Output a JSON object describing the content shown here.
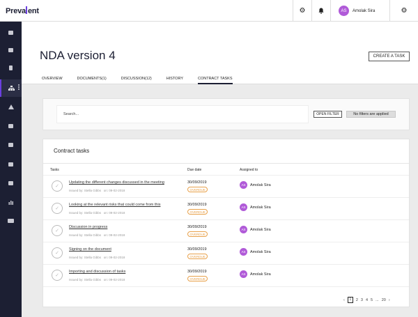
{
  "app": {
    "logo_left": "Preva",
    "logo_right": "ent"
  },
  "topbar": {
    "gear_icon": "gear-icon",
    "bell_icon": "bell-icon",
    "user": {
      "initials": "AS",
      "name": "Amolak Sira"
    },
    "settings_icon": "gear-icon"
  },
  "sidebar": {
    "items": [
      "dashboard-icon",
      "checklist-icon",
      "document-icon",
      "org-chart-icon",
      "warning-icon",
      "list-icon",
      "calendar-icon",
      "book-icon",
      "lines-icon",
      "bar-chart-icon",
      "team-icon"
    ],
    "active_index": 3
  },
  "header": {
    "title": "NDA version 4",
    "create_label": "CREATE A TASK",
    "tabs": [
      "OVERVIEW",
      "DOCUMENTS(1)",
      "DISCUSSION(12)",
      "HISTORY",
      "CONTRACT TASKS"
    ],
    "active_tab": 4
  },
  "filter": {
    "search_placeholder": "Search...",
    "open_filter_label": "OPEN FILTER",
    "status": "No filters are applied"
  },
  "card": {
    "title": "Contract tasks",
    "columns": [
      "Tasks",
      "Due date",
      "Assigned to"
    ],
    "rows": [
      {
        "title": "Updating the different changes discussed in the meeting",
        "issued_by": "Issued by: Stella Gibbs",
        "issued_on": "on: 09-02-2018",
        "due": "30/09/2019",
        "status": "OVERDUE",
        "initials": "AS",
        "assignee": "Amolak Sira"
      },
      {
        "title": "Looking at the relevant risks that could come from this",
        "issued_by": "Issued by: Stella Gibbs",
        "issued_on": "on: 09-02-2018",
        "due": "30/09/2019",
        "status": "OVERDUE",
        "initials": "AS",
        "assignee": "Amolak Sira"
      },
      {
        "title": "Discussion in progress",
        "issued_by": "Issued by: Stella Gibbs",
        "issued_on": "on: 09-02-2018",
        "due": "30/09/2019",
        "status": "OVERDUE",
        "initials": "AS",
        "assignee": "Amolak Sira"
      },
      {
        "title": "Signing on the document",
        "issued_by": "Issued by: Stella Gibbs",
        "issued_on": "on: 09-02-2018",
        "due": "30/09/2019",
        "status": "OVERDUE",
        "initials": "AS",
        "assignee": "Amolak Sira"
      },
      {
        "title": "Importing and discussion of tasks",
        "issued_by": "Issued by: Stella Gibbs",
        "issued_on": "on: 09-02-2018",
        "due": "30/09/2019",
        "status": "OVERDUE",
        "initials": "AS",
        "assignee": "Amolak Sira"
      }
    ]
  },
  "pagination": {
    "prev": "‹",
    "pages": [
      "1",
      "2",
      "3",
      "4",
      "5",
      "...",
      "20"
    ],
    "current": "1",
    "next": "›"
  },
  "colors": {
    "sidebar": "#1c1f33",
    "accent": "#6b3fe0",
    "avatar": "#b05ad8",
    "overdue": "#e8a14a"
  }
}
